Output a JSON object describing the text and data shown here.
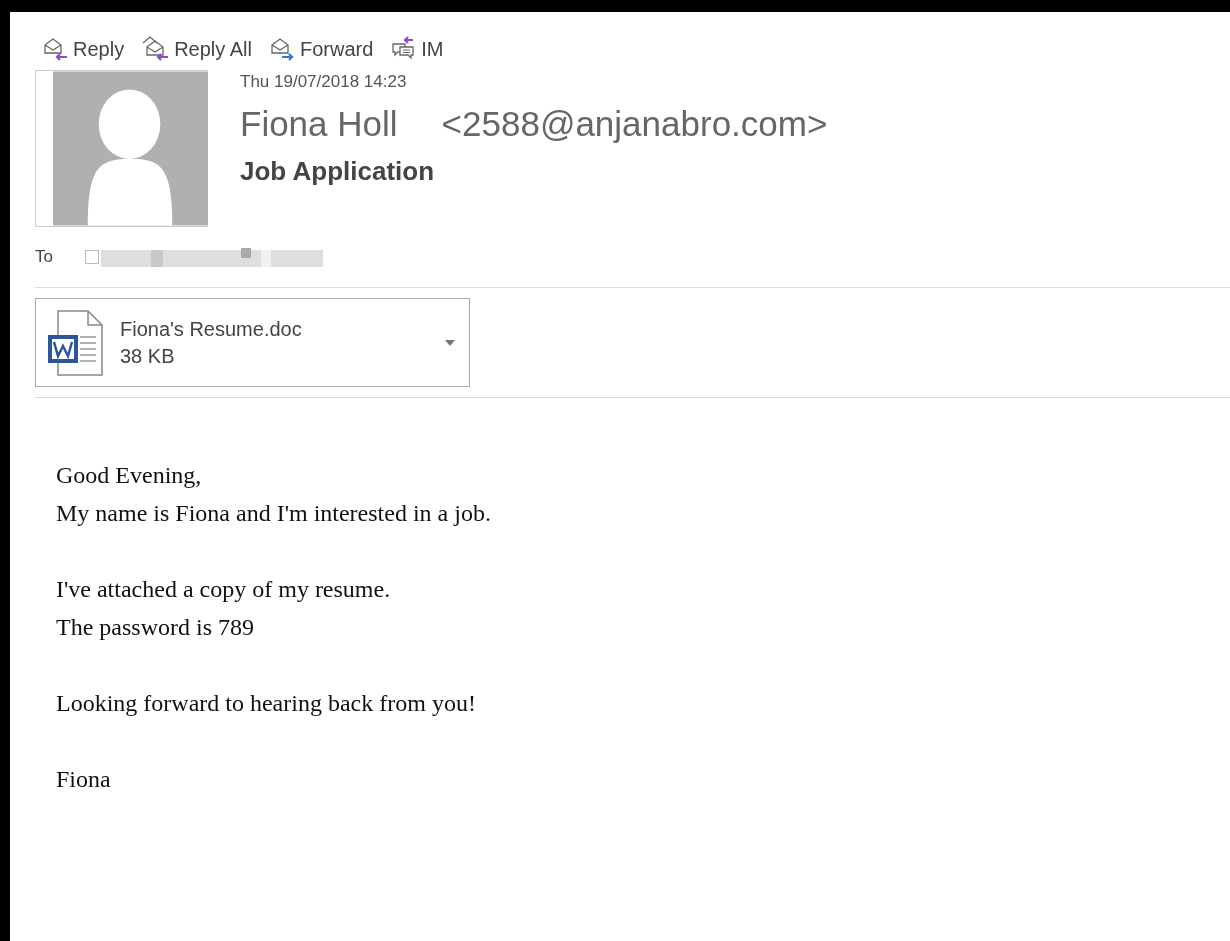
{
  "toolbar": [
    {
      "label": "Reply",
      "kind": "reply"
    },
    {
      "label": "Reply All",
      "kind": "reply_all"
    },
    {
      "label": "Forward",
      "kind": "forward"
    },
    {
      "label": "IM",
      "kind": "im"
    }
  ],
  "message": {
    "date": "Thu 19/07/2018 14:23",
    "sender_name": "Fiona Holl",
    "sender_address": "<2588@anjanabro.com>",
    "subject": "Job Application",
    "to_label": "To",
    "recipient": {
      "checked": false
    }
  },
  "attachment": {
    "name": "Fiona's Resume.doc",
    "size": "38 KB"
  },
  "body": {
    "paragraphs": [
      [
        "Good Evening,",
        "My name is Fiona and I'm interested in a job."
      ],
      [
        "I've attached a copy of my resume.",
        "The password is 789"
      ],
      [
        "Looking forward to hearing back from you!"
      ],
      [
        "Fiona"
      ]
    ]
  }
}
